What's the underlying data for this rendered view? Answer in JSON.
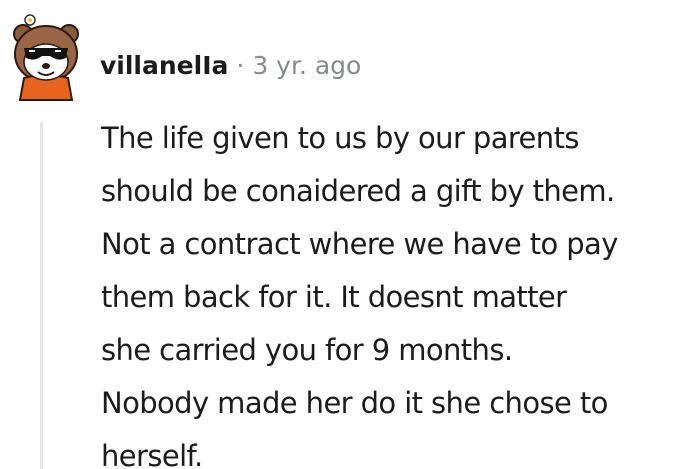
{
  "comment": {
    "author": "villanelIa",
    "separator": "·",
    "timestamp": "3 yr. ago",
    "avatar_icon": "bear-avatar-with-sunglasses-icon",
    "body_lines": [
      "The life given to us by our parents",
      "should be conaidered a gift by them.",
      "Not a contract where we have to pay",
      "them back for it. It doesnt matter",
      "she carried you for 9 months.",
      "Nobody made her do it she chose to",
      "herself."
    ]
  },
  "colors": {
    "text": "#1c1c1c",
    "meta": "#878a8c",
    "thread_line": "#e4e6e8",
    "avatar_fur": "#8a5a3c",
    "avatar_shirt": "#e8641e"
  }
}
